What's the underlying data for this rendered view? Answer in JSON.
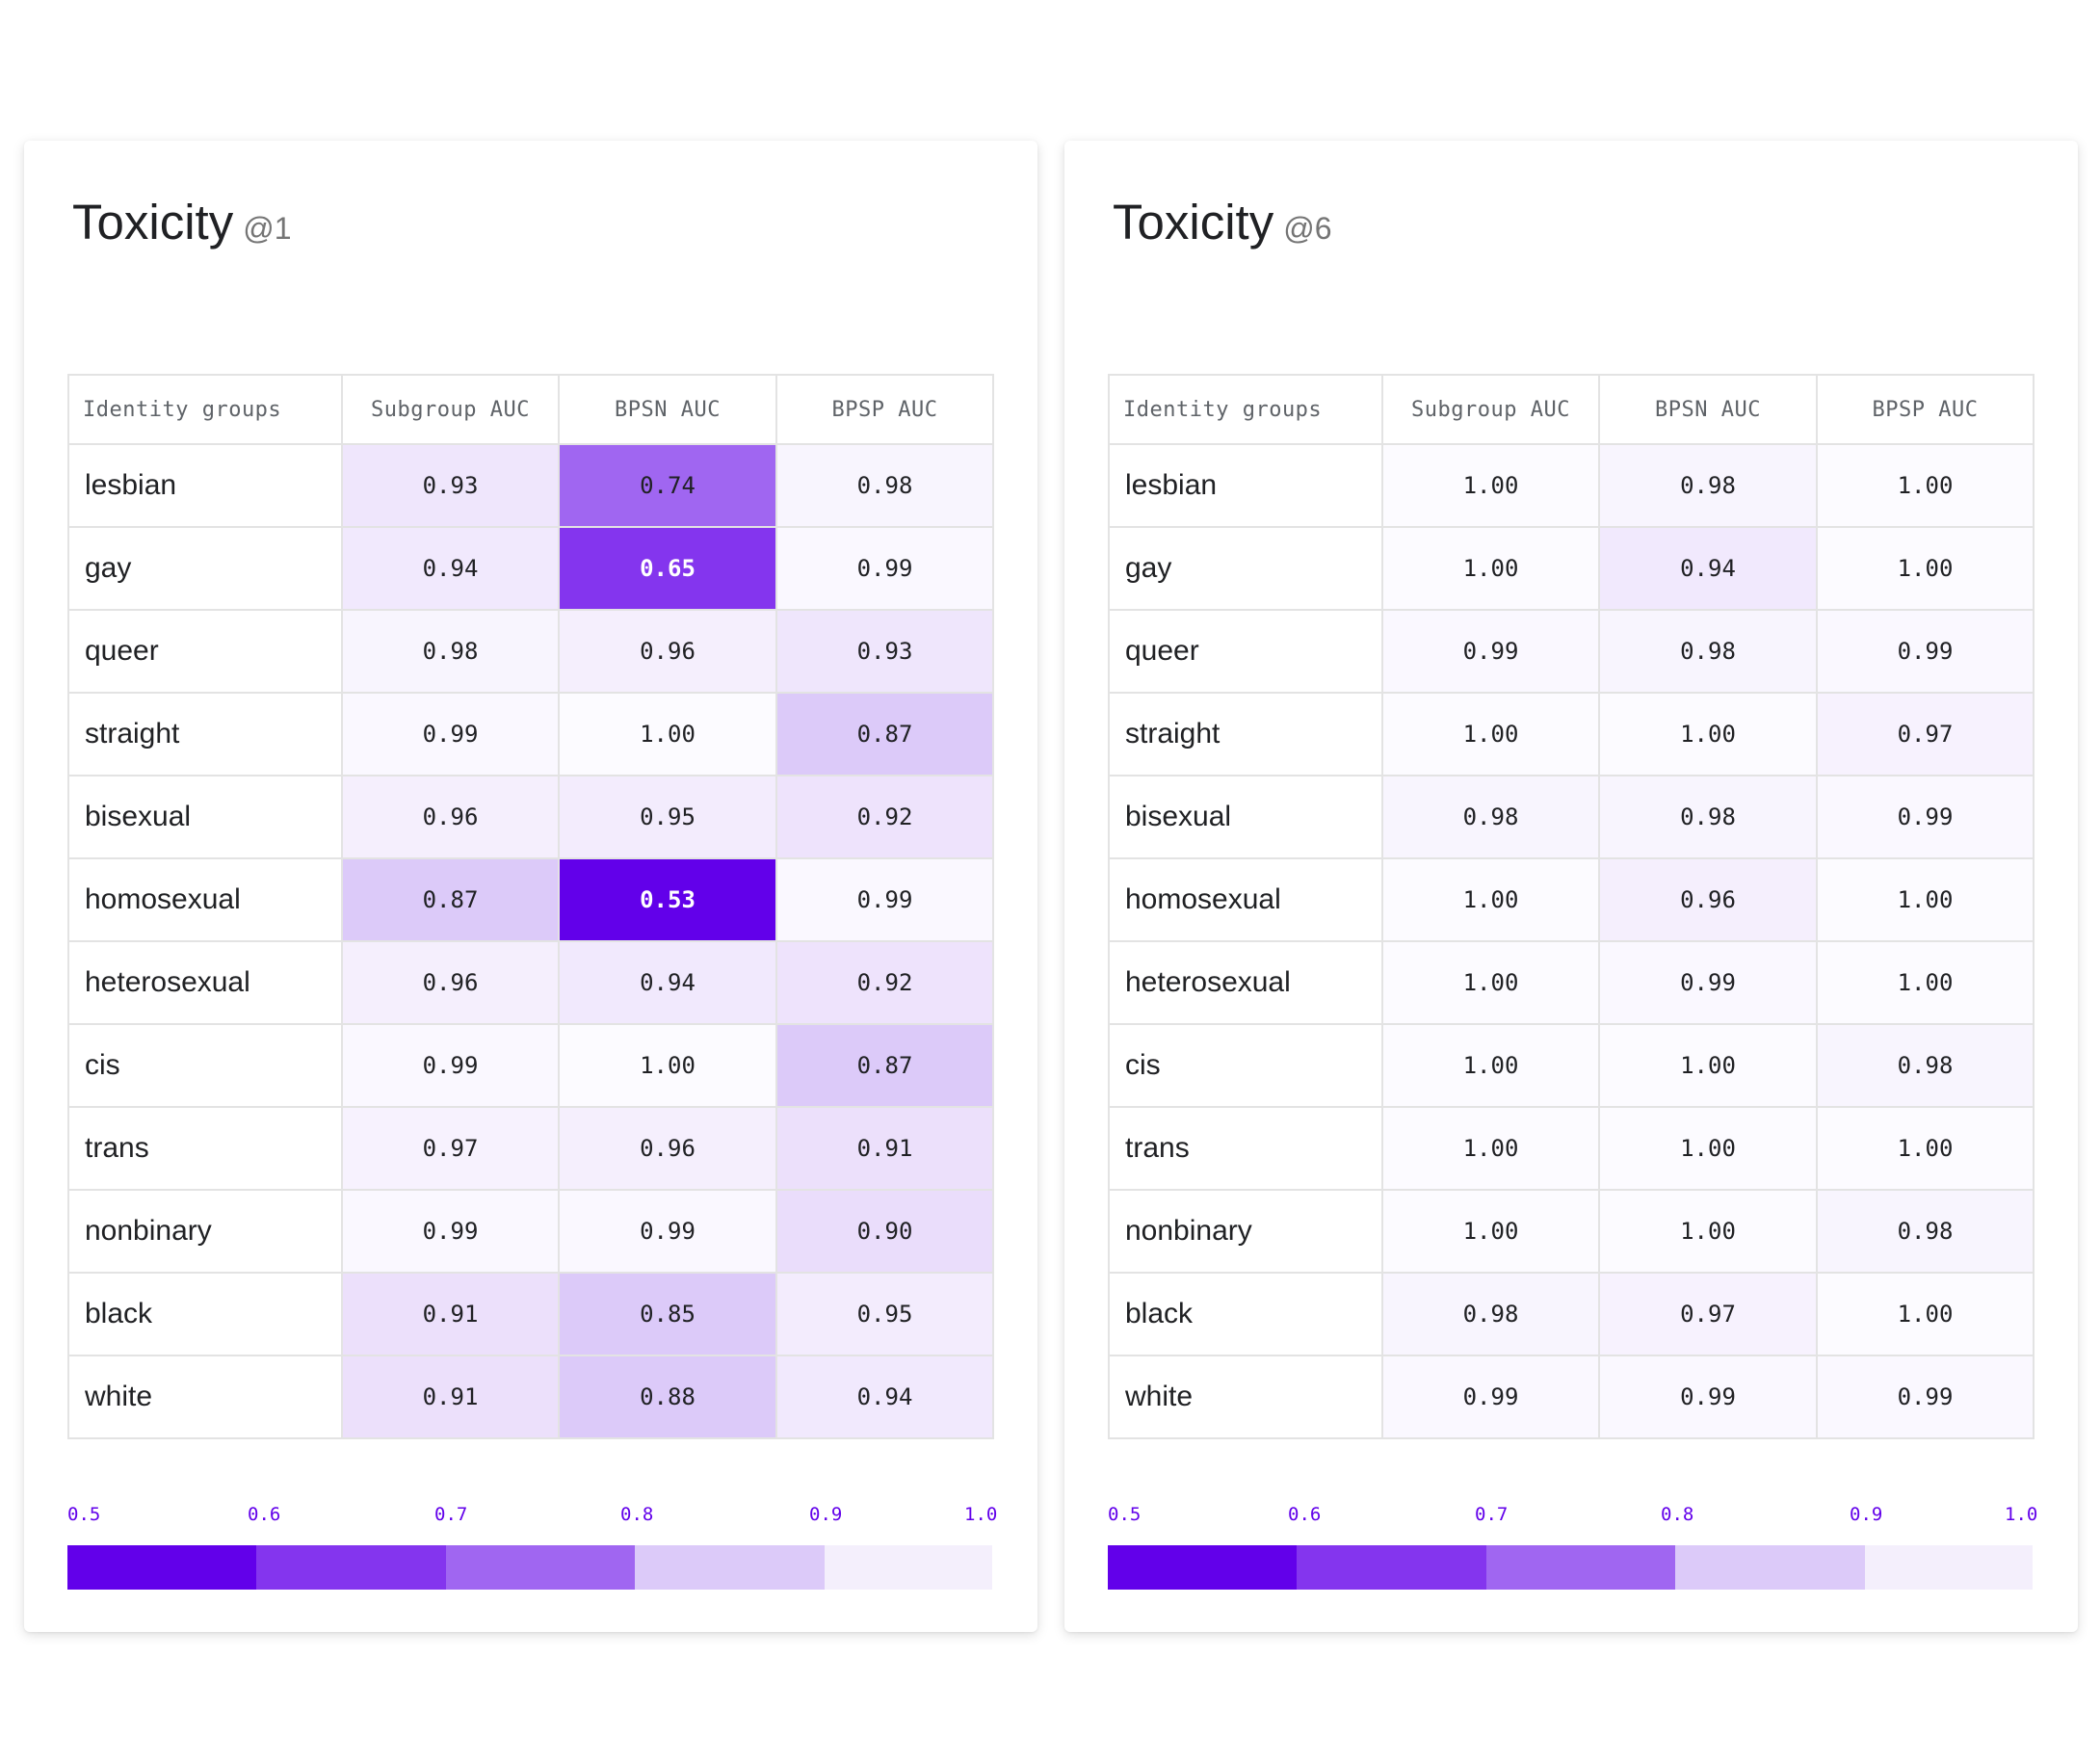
{
  "colors": {
    "scale": [
      "#6200ea",
      "#8435ee",
      "#a066f1",
      "#dccaf9",
      "#f4effc"
    ],
    "tick": "#6200ea"
  },
  "chart_data": [
    {
      "type": "heatmap",
      "title": "Toxicity",
      "title_suffix": "@1",
      "columns": [
        "Identity groups",
        "Subgroup AUC",
        "BPSN AUC",
        "BPSP AUC"
      ],
      "rows": [
        "lesbian",
        "gay",
        "queer",
        "straight",
        "bisexual",
        "homosexual",
        "heterosexual",
        "cis",
        "trans",
        "nonbinary",
        "black",
        "white"
      ],
      "values": [
        [
          "0.93",
          "0.74",
          "0.98"
        ],
        [
          "0.94",
          "0.65",
          "0.99"
        ],
        [
          "0.98",
          "0.96",
          "0.93"
        ],
        [
          "0.99",
          "1.00",
          "0.87"
        ],
        [
          "0.96",
          "0.95",
          "0.92"
        ],
        [
          "0.87",
          "0.53",
          "0.99"
        ],
        [
          "0.96",
          "0.94",
          "0.92"
        ],
        [
          "0.99",
          "1.00",
          "0.87"
        ],
        [
          "0.97",
          "0.96",
          "0.91"
        ],
        [
          "0.99",
          "0.99",
          "0.90"
        ],
        [
          "0.91",
          "0.85",
          "0.95"
        ],
        [
          "0.91",
          "0.88",
          "0.94"
        ]
      ],
      "legend_ticks": [
        "0.5",
        "0.6",
        "0.7",
        "0.8",
        "0.9",
        "1.0"
      ],
      "color_range": [
        0.5,
        1.0
      ]
    },
    {
      "type": "heatmap",
      "title": "Toxicity",
      "title_suffix": "@6",
      "columns": [
        "Identity groups",
        "Subgroup AUC",
        "BPSN AUC",
        "BPSP AUC"
      ],
      "rows": [
        "lesbian",
        "gay",
        "queer",
        "straight",
        "bisexual",
        "homosexual",
        "heterosexual",
        "cis",
        "trans",
        "nonbinary",
        "black",
        "white"
      ],
      "values": [
        [
          "1.00",
          "0.98",
          "1.00"
        ],
        [
          "1.00",
          "0.94",
          "1.00"
        ],
        [
          "0.99",
          "0.98",
          "0.99"
        ],
        [
          "1.00",
          "1.00",
          "0.97"
        ],
        [
          "0.98",
          "0.98",
          "0.99"
        ],
        [
          "1.00",
          "0.96",
          "1.00"
        ],
        [
          "1.00",
          "0.99",
          "1.00"
        ],
        [
          "1.00",
          "1.00",
          "0.98"
        ],
        [
          "1.00",
          "1.00",
          "1.00"
        ],
        [
          "1.00",
          "1.00",
          "0.98"
        ],
        [
          "0.98",
          "0.97",
          "1.00"
        ],
        [
          "0.99",
          "0.99",
          "0.99"
        ]
      ],
      "legend_ticks": [
        "0.5",
        "0.6",
        "0.7",
        "0.8",
        "0.9",
        "1.0"
      ],
      "color_range": [
        0.5,
        1.0
      ]
    }
  ]
}
